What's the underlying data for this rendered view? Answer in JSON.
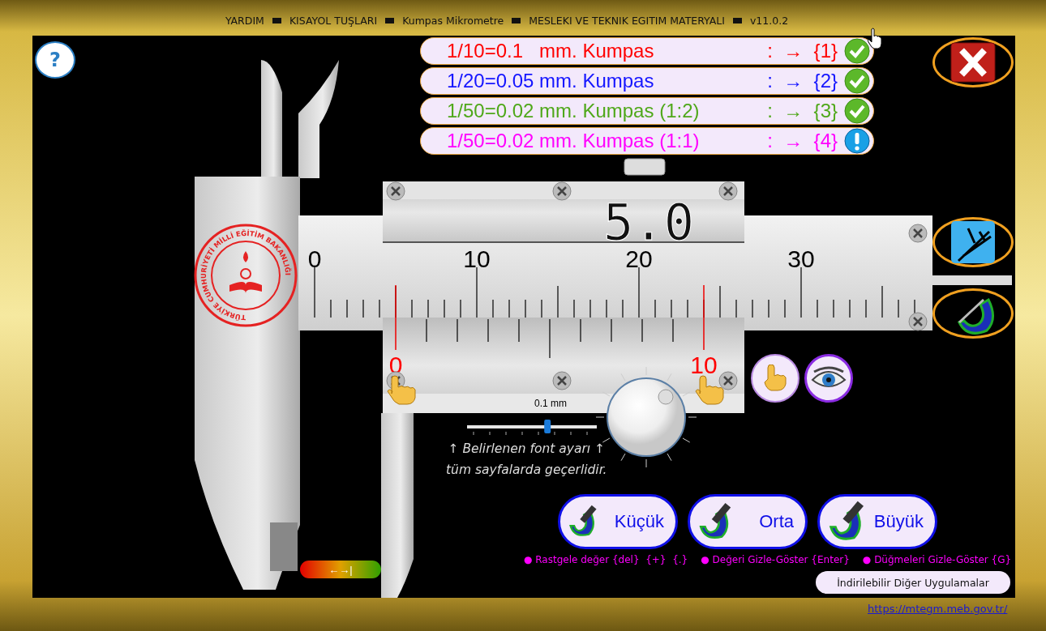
{
  "title_bar": {
    "items": [
      "YARDIM",
      "KISAYOL TUŞLARI",
      "Kumpas Mikrometre",
      "MESLEKI VE TEKNIK EGITIM MATERYALI",
      "v11.0.2"
    ]
  },
  "help_button": "?",
  "modes": [
    {
      "label": "1/10=0.1   mm. Kumpas",
      "shortcut": ":  →  {1}",
      "color": "#ff0000",
      "kind": "done"
    },
    {
      "label": "1/20=0.05 mm. Kumpas",
      "shortcut": ":  →  {2}",
      "color": "#1515ff",
      "kind": "done"
    },
    {
      "label": "1/50=0.02 mm. Kumpas (1:2)",
      "shortcut": ":  →  {3}",
      "color": "#4fa81a",
      "kind": "done"
    },
    {
      "label": "1/50=0.02 mm. Kumpas (1:1)",
      "shortcut": ":  →  {4}",
      "color": "#ff00ff",
      "kind": "pending"
    }
  ],
  "seal_text": "TÜRKİYE CUMHURİYETİ MİLLİ EĞİTİM BAKANLIĞI",
  "readout": "5.0",
  "main_scale": {
    "labels": [
      "0",
      "10",
      "20",
      "30"
    ]
  },
  "vernier": {
    "labels": [
      "0",
      "10"
    ],
    "resolution": "0.1 mm"
  },
  "font_slider": {
    "level": 0.62
  },
  "font_note": [
    "↑ Belirlenen font ayarı ↑",
    "tüm sayfalarda geçerlidir."
  ],
  "slide_button": "←→|",
  "size_buttons": [
    {
      "label": "Küçük"
    },
    {
      "label": "Orta"
    },
    {
      "label": "Büyük"
    }
  ],
  "shortcuts": [
    "● Rastgele değer {del}  {+}  {.}",
    "● Değeri Gizle-Göster {Enter}",
    "● Düğmeleri Gizle-Göster {G}"
  ],
  "downloads_button": "İndirilebilir Diğer Uygulamalar",
  "link": "https://mtegm.meb.gov.tr/"
}
